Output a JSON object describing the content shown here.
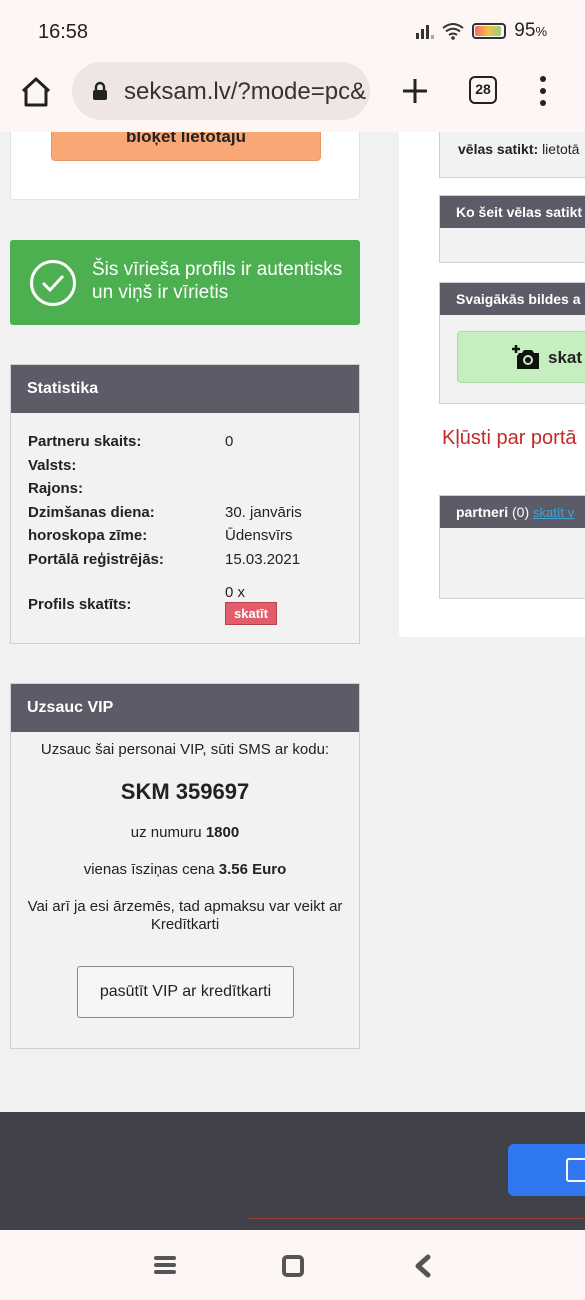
{
  "status_bar": {
    "time": "16:58",
    "battery": "95",
    "battery_unit": "%"
  },
  "browser": {
    "url": "seksam.lv/?mode=pc&",
    "tab_count": "28"
  },
  "block_user": {
    "label": "bloķēt lietotāju"
  },
  "auth_notice": {
    "text": "Šis vīrieša profils ir autentisks un viņš ir vīrietis"
  },
  "stats": {
    "title": "Statistika",
    "rows": [
      {
        "label": "Partneru skaits:",
        "value": "0"
      },
      {
        "label": "Valsts:",
        "value": ""
      },
      {
        "label": "Rajons:",
        "value": ""
      },
      {
        "label": "Dzimšanas diena:",
        "value": "30. janvāris"
      },
      {
        "label": "horoskopa zīme:",
        "value": "Ūdensvīrs"
      },
      {
        "label": "Portālā reģistrējās:",
        "value": "15.03.2021"
      }
    ],
    "views_label": "Profils skatīts:",
    "views_value": "0 x",
    "views_button": "skatīt"
  },
  "vip": {
    "title": "Uzsauc VIP",
    "intro": "Uzsauc šai personai VIP, sūti SMS ar kodu:",
    "code": "SKM 359697",
    "number_prefix": "uz numuru ",
    "number": "1800",
    "price_prefix": "vienas īsziņas cena ",
    "price": "3.56 Euro",
    "alt_text": "Vai arī ja esi ārzemēs, tad apmaksu var veikt ar Kredītkarti",
    "card_button": "pasūtīt VIP ar kredītkarti"
  },
  "right": {
    "meet_label": "vēlas satikt:",
    "meet_value": "lietotā",
    "wants_title": "Ko šeit vēlas satikt",
    "photos_title": "Svaigākās bildes a",
    "photos_button": "skat",
    "become_portal": "Kļūsti par portā",
    "partners_title": "partneri",
    "partners_count": "(0)",
    "partners_link": "skatīt v"
  }
}
